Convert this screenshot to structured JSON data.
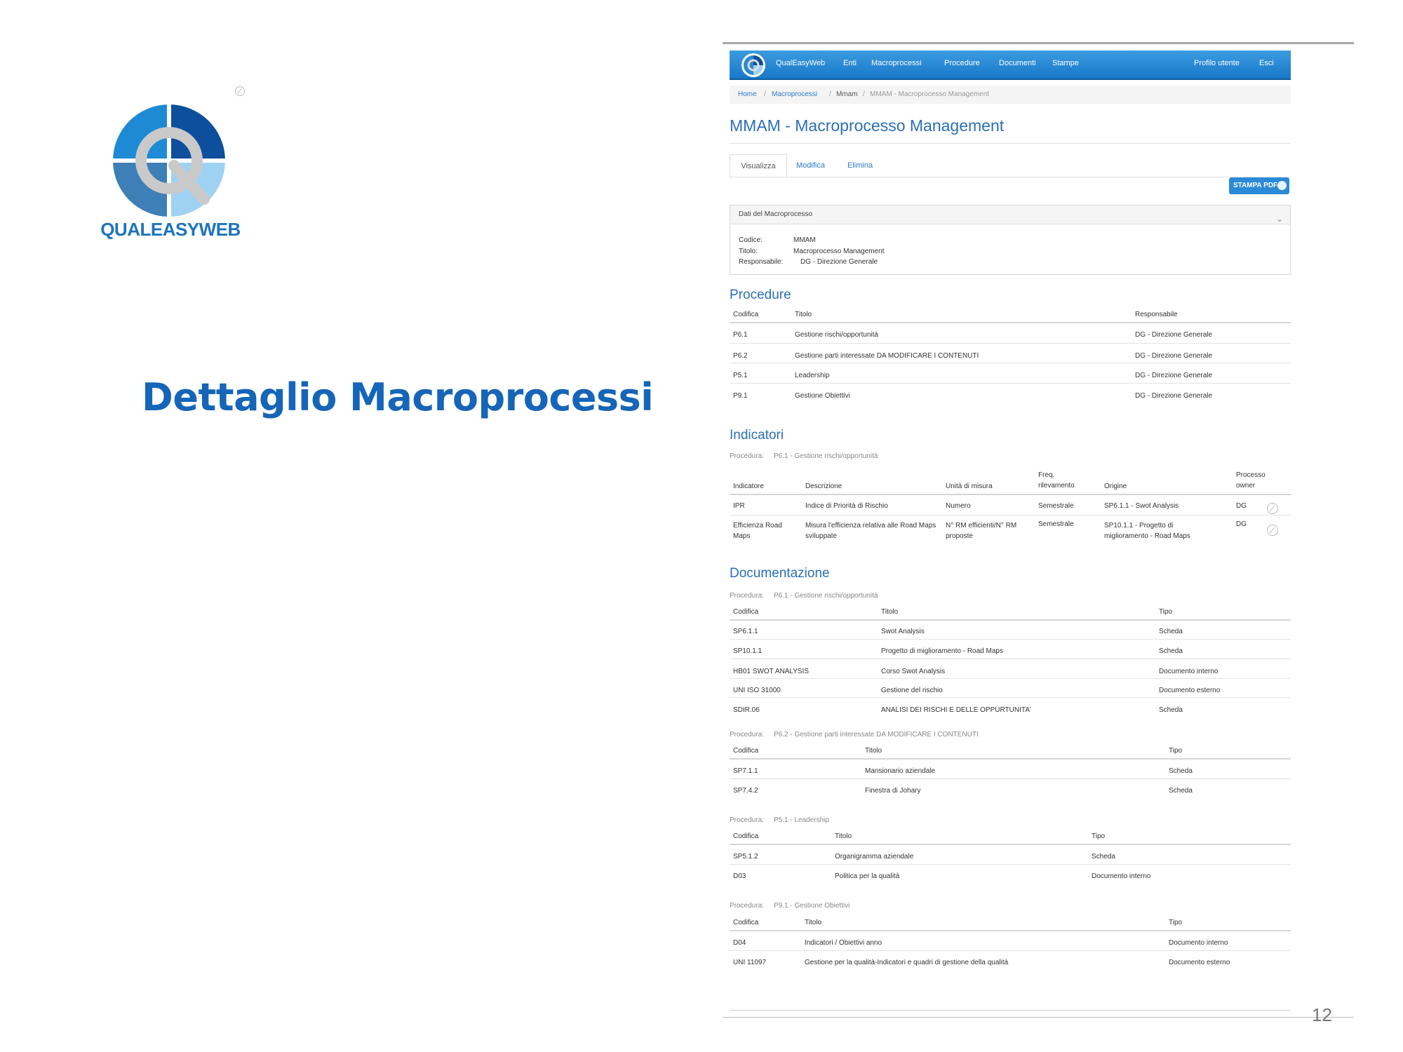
{
  "logo": {
    "brand": "QUALEASYWEB"
  },
  "slide": {
    "title": "Dettaglio Macroprocessi",
    "page_number": "12"
  },
  "navbar": {
    "brand": "QualEasyWeb",
    "items": [
      "Enti",
      "Macroprocessi",
      "Procedure",
      "Documenti",
      "Stampe"
    ],
    "right_items": [
      "Profilo utente",
      "Esci"
    ]
  },
  "breadcrumb": [
    "Home",
    "Macroprocessi",
    "Mmam",
    "MMAM - Macroprocesso Management"
  ],
  "page": {
    "title": "MMAM - Macroprocesso Management"
  },
  "tabs": [
    "Visualizza",
    "Modifica",
    "Elimina"
  ],
  "print_label": "STAMPA PDF",
  "panel": {
    "title": "Dati del Macroprocesso",
    "fields": [
      {
        "label": "Codice:",
        "value": "MMAM"
      },
      {
        "label": "Titolo:",
        "value": "Macroprocesso Management"
      },
      {
        "label": "Responsabile:",
        "value": "DG - Direzione Generale"
      }
    ]
  },
  "procedure": {
    "title": "Procedure",
    "headers": [
      "Codifica",
      "Titolo",
      "Responsabile"
    ],
    "rows": [
      [
        "P6.1",
        "Gestione rischi/opportunità",
        "DG - Direzione Generale"
      ],
      [
        "P6.2",
        "Gestione parti interessate DA MODIFICARE I CONTENUTI",
        "DG - Direzione Generale"
      ],
      [
        "P5.1",
        "Leadership",
        "DG - Direzione Generale"
      ],
      [
        "P9.1",
        "Gestione Obiettivi",
        "DG - Direzione Generale"
      ]
    ]
  },
  "indicatori": {
    "title": "Indicatori",
    "procedura_label": "Procedura:",
    "procedura": "P6.1 - Gestione rischi/opportunità",
    "headers": [
      "Indicatore",
      "Descrizione",
      "Unità di misura",
      "Freq. rilevamento",
      "Origine",
      "Processo owner"
    ],
    "rows": [
      [
        "IPR",
        "Indice di Priorità di Rischio",
        "Numero",
        "Semestrale",
        "SP6.1.1 - Swot Analysis",
        "DG"
      ],
      [
        "Efficienza Road Maps",
        "Misura l'efficienza relativa alle Road Maps sviluppate",
        "N° RM efficienti/N° RM proposte",
        "Semestrale",
        "SP10.1.1 - Progetto di miglioramento - Road Maps",
        "DG"
      ]
    ]
  },
  "documentazione": {
    "title": "Documentazione",
    "groups": [
      {
        "procedura_label": "Procedura:",
        "procedura": "P6.1 - Gestione rischi/opportunità",
        "headers": [
          "Codifica",
          "Titolo",
          "Tipo"
        ],
        "rows": [
          [
            "SP6.1.1",
            "Swot Analysis",
            "Scheda"
          ],
          [
            "SP10.1.1",
            "Progetto di miglioramento - Road Maps",
            "Scheda"
          ],
          [
            "HB01 SWOT ANALYSIS",
            "Corso Swot Analysis",
            "Documento interno"
          ],
          [
            "UNI ISO 31000",
            "Gestione del rischio",
            "Documento esterno"
          ],
          [
            "SDIR.06",
            "ANALISI DEI RISCHI E DELLE OPPURTUNITA'",
            "Scheda"
          ]
        ]
      },
      {
        "procedura_label": "Procedura:",
        "procedura": "P6.2 - Gestione parti interessate DA MODIFICARE I CONTENUTI",
        "headers": [
          "Codifica",
          "Titolo",
          "Tipo"
        ],
        "rows": [
          [
            "SP7.1.1",
            "Mansionario aziendale",
            "Scheda"
          ],
          [
            "SP7.4.2",
            "Finestra di Johary",
            "Scheda"
          ]
        ]
      },
      {
        "procedura_label": "Procedura:",
        "procedura": "P5.1 - Leadership",
        "headers": [
          "Codifica",
          "Titolo",
          "Tipo"
        ],
        "rows": [
          [
            "SP5.1.2",
            "Organigramma aziendale",
            "Scheda"
          ],
          [
            "D03",
            "Politica per la qualità",
            "Documento interno"
          ]
        ]
      },
      {
        "procedura_label": "Procedura:",
        "procedura": "P9.1 - Gestione Obiettivi",
        "headers": [
          "Codifica",
          "Titolo",
          "Tipo"
        ],
        "rows": [
          [
            "D04",
            "Indicatori / Obiettivi anno",
            "Documento interno"
          ],
          [
            "UNI 11097",
            "Gestione per la qualità-Indicatori e quadri di gestione della qualità",
            "Documento esterno"
          ]
        ]
      }
    ]
  }
}
